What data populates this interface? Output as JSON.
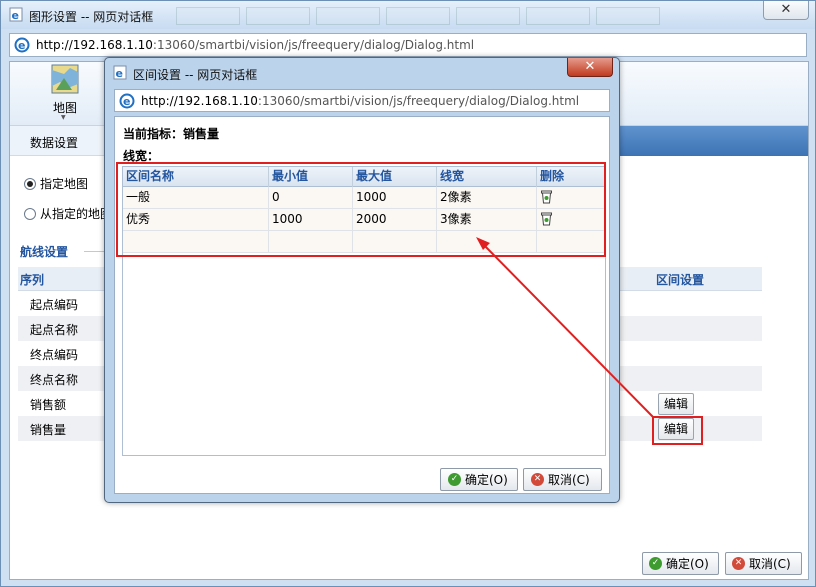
{
  "outer": {
    "title": "图形设置 -- 网页对话框",
    "close": "✕",
    "url_host": "http://192.168.1.10",
    "url_path": ":13060/smartbi/vision/js/freequery/dialog/Dialog.html",
    "ribbon": {
      "map_label": "地图"
    },
    "tabs": {
      "data_settings": "数据设置"
    },
    "radios": {
      "specified_map": "指定地图",
      "from_specified_map": "从指定的地图"
    },
    "route_section": {
      "title": "航线设置"
    },
    "grid": {
      "col_seq": "序列",
      "col_range": "区间设置",
      "rows": [
        {
          "label": "起点编码"
        },
        {
          "label": "起点名称"
        },
        {
          "label": "终点编码"
        },
        {
          "label": "终点名称"
        },
        {
          "label": "销售额",
          "edit": "编辑"
        },
        {
          "label": "销售量",
          "edit": "编辑"
        }
      ]
    },
    "footer": {
      "ok": "确定(O)",
      "cancel": "取消(C)"
    }
  },
  "inner": {
    "title": "区间设置 -- 网页对话框",
    "close": "✕",
    "url_host": "http://192.168.1.10",
    "url_path": ":13060/smartbi/vision/js/freequery/dialog/Dialog.html",
    "current_indicator": "当前指标：销售量",
    "line_width_label": "线宽：",
    "grid": {
      "headers": [
        "区间名称",
        "最小值",
        "最大值",
        "线宽",
        "删除"
      ],
      "rows": [
        {
          "name": "一般",
          "min": "0",
          "max": "1000",
          "width": "2像素"
        },
        {
          "name": "优秀",
          "min": "1000",
          "max": "2000",
          "width": "3像素"
        }
      ]
    },
    "footer": {
      "ok": "确定(O)",
      "cancel": "取消(C)"
    }
  },
  "icons": {
    "title": "ie-page-icon",
    "address": "ie-e-icon",
    "ribbon_map": "map-icon",
    "delete": "trash-icon",
    "ok": "check-circle-icon",
    "cancel": "x-circle-icon"
  },
  "colors": {
    "annotation_red": "#e02020",
    "header_text": "#2456a0",
    "ok_green": "#3d9b2f",
    "cancel_red": "#d24a3a"
  }
}
